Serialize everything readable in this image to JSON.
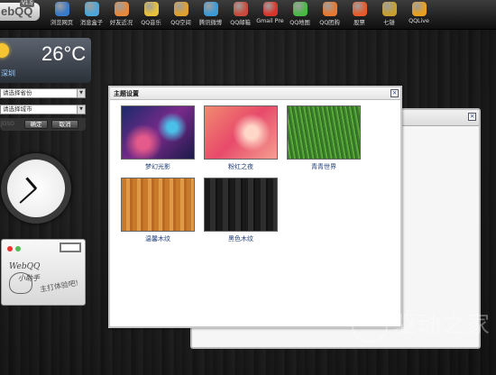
{
  "taskbar": {
    "logo_text": "ebQQ",
    "version": "V1.5",
    "apps": [
      {
        "label": "浏览网页",
        "icon": "globe-icon",
        "color": "#3a78c8"
      },
      {
        "label": "消息盒子",
        "icon": "chat-bubble-icon",
        "color": "#4aa7d8"
      },
      {
        "label": "好友近况",
        "icon": "friends-icon",
        "color": "#e8883a"
      },
      {
        "label": "QQ音乐",
        "icon": "music-icon",
        "color": "#e8c23a"
      },
      {
        "label": "QQ空间",
        "icon": "star-icon",
        "color": "#e0a030"
      },
      {
        "label": "腾讯微博",
        "icon": "weibo-icon",
        "color": "#3a9ad8"
      },
      {
        "label": "QQ邮箱",
        "icon": "mail-icon",
        "color": "#c84a3a"
      },
      {
        "label": "Gmail Pre",
        "icon": "gmail-icon",
        "color": "#d8352a"
      },
      {
        "label": "QQ地图",
        "icon": "map-icon",
        "color": "#4ab848"
      },
      {
        "label": "QQ团购",
        "icon": "group-buy-icon",
        "color": "#e87830"
      },
      {
        "label": "股票",
        "icon": "stock-icon",
        "color": "#e85a2a"
      },
      {
        "label": "七雄",
        "icon": "game-icon",
        "color": "#c8a030"
      },
      {
        "label": "QQLive",
        "icon": "play-icon",
        "color": "#e8a020"
      }
    ]
  },
  "weather": {
    "temperature": "26°C",
    "city": "深圳",
    "icon": "sun-cloud-icon"
  },
  "location": {
    "province_placeholder": "请选择省份",
    "city_placeholder": "请选择城市",
    "confirm_label": "确定",
    "cancel_label": "取消",
    "faded_text": "JOSO"
  },
  "clock": {
    "hour": 10,
    "minute": 38
  },
  "memo": {
    "line1": "WebQQ",
    "line2": "小助手",
    "line3": "主打体验吧!"
  },
  "back_window": {
    "title": ""
  },
  "dialog": {
    "title": "主题设置",
    "themes": [
      {
        "label": "梦幻光影",
        "icon": "dreamy-light-thumbnail"
      },
      {
        "label": "粉红之夜",
        "icon": "pink-night-thumbnail"
      },
      {
        "label": "青青世界",
        "icon": "green-grass-thumbnail"
      },
      {
        "label": "温馨木纹",
        "icon": "warm-wood-thumbnail"
      },
      {
        "label": "黑色木纹",
        "icon": "black-wood-thumbnail"
      }
    ]
  },
  "watermark": {
    "text": "驱动之家"
  }
}
